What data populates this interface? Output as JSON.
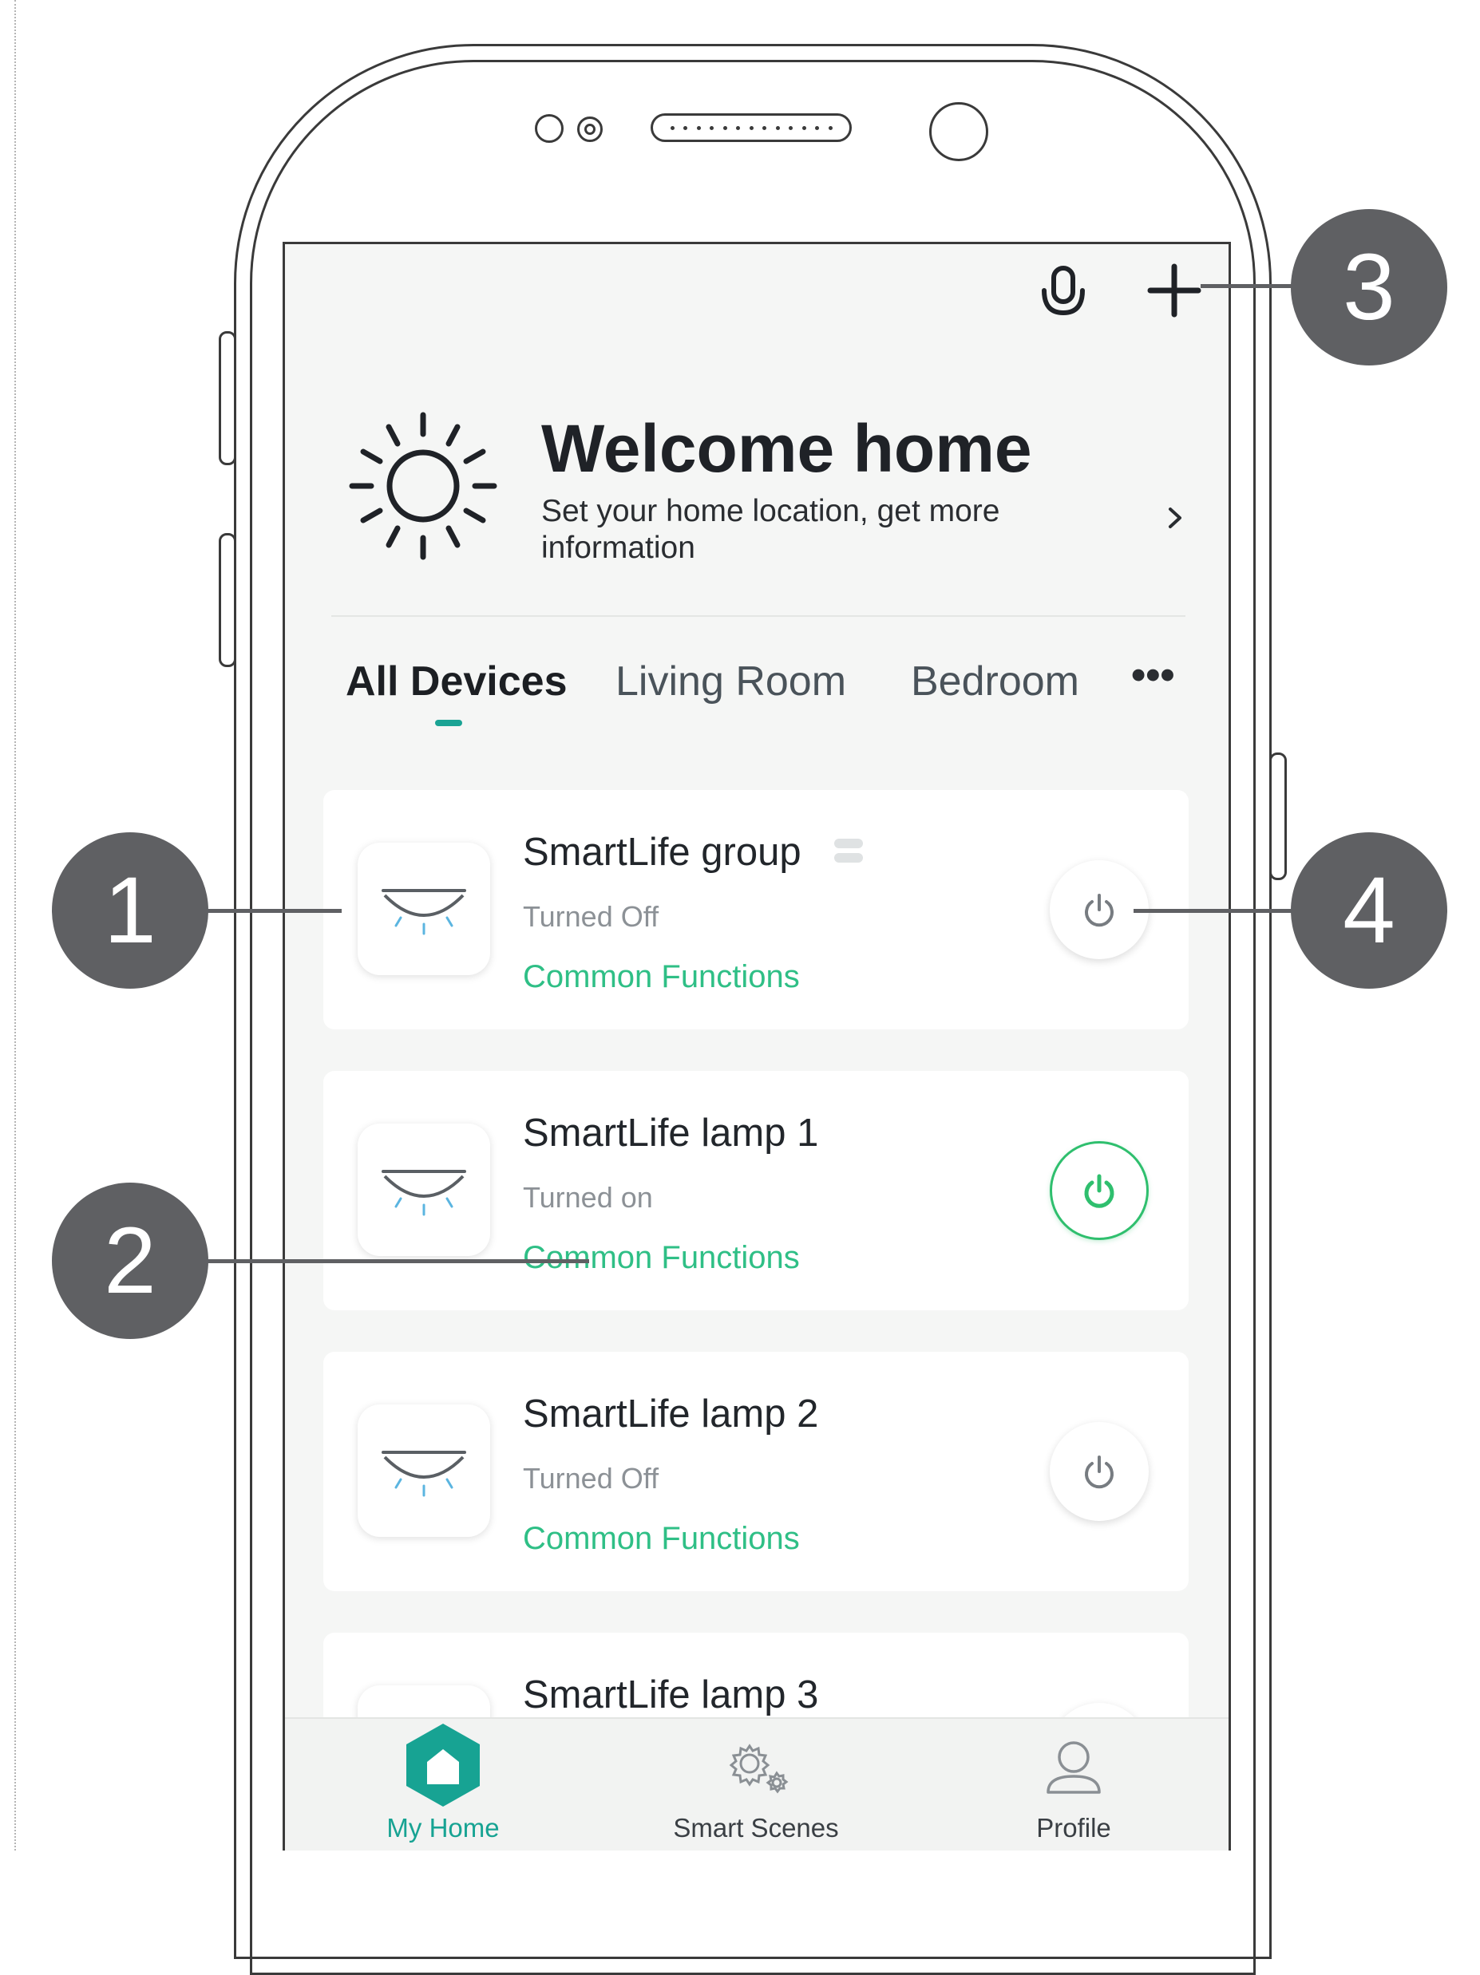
{
  "header": {
    "mic_icon": "microphone-icon",
    "add_icon": "plus-icon"
  },
  "welcome": {
    "title": "Welcome home",
    "subtitle": "Set your home location, get more information",
    "icon": "sun-icon"
  },
  "tabs": [
    {
      "label": "All Devices",
      "active": true
    },
    {
      "label": "Living Room",
      "active": false
    },
    {
      "label": "Bedroom",
      "active": false
    },
    {
      "label": "•••",
      "active": false
    }
  ],
  "devices": [
    {
      "name": "SmartLife group",
      "status": "Turned Off",
      "functions": "Common Functions",
      "on": false
    },
    {
      "name": "SmartLife lamp 1",
      "status": "Turned on",
      "functions": "Common Functions",
      "on": true
    },
    {
      "name": "SmartLife lamp 2",
      "status": "Turned Off",
      "functions": "Common Functions",
      "on": false
    },
    {
      "name": "SmartLife lamp 3",
      "status": "",
      "functions": "",
      "on": false
    }
  ],
  "nav": {
    "home": "My Home",
    "scenes": "Smart Scenes",
    "profile": "Profile"
  },
  "callouts": [
    "1",
    "2",
    "3",
    "4"
  ],
  "colors": {
    "accent": "#1aa394",
    "green": "#2fbf86",
    "power_on": "#2fbf6e",
    "callout": "#5f6063"
  }
}
